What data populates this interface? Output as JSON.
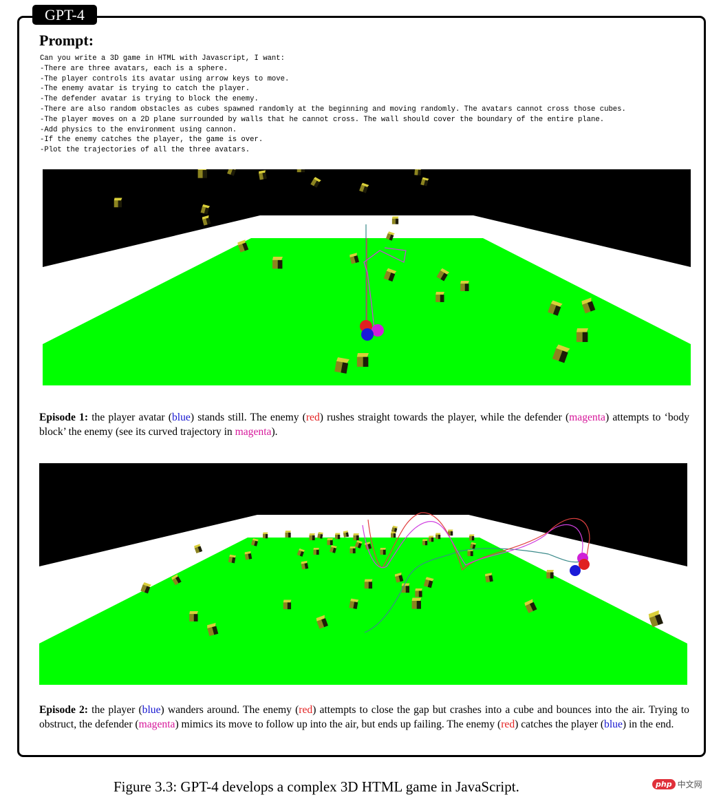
{
  "badge": "GPT-4",
  "prompt": {
    "title": "Prompt:",
    "lines": [
      "Can you write a 3D game in HTML with Javascript, I want:",
      "-There are three avatars, each is a sphere.",
      "-The player controls its avatar using arrow keys to move.",
      "-The enemy avatar is trying to catch the player.",
      "-The defender avatar is trying to block the enemy.",
      "-There are also random obstacles as cubes spawned randomly at the beginning and moving randomly. The avatars cannot cross those cubes.",
      "-The player moves on a 2D plane surrounded by walls that he cannot cross. The wall should cover the boundary of the entire plane.",
      "-Add physics to the environment using cannon.",
      "-If the enemy catches the player, the game is over.",
      "-Plot the trajectories of all the three avatars."
    ]
  },
  "colors": {
    "sky": "#000000",
    "wall": "#ffffff",
    "floor": "#00ff00",
    "cube_top": "#d9cf3a",
    "cube_side": "#8c8420",
    "cube_dark": "#1e1c08",
    "player": "#1a1ad8",
    "enemy": "#e02020",
    "defender": "#d020d8",
    "trail_player": "#3a8a8a",
    "trail_enemy": "#e04040",
    "trail_defender": "#d040e0"
  },
  "episodes": [
    {
      "label": "Episode 1:",
      "caption": [
        {
          "t": " the player avatar ("
        },
        {
          "t": "blue",
          "c": "c-blue"
        },
        {
          "t": ") stands still.  The enemy ("
        },
        {
          "t": "red",
          "c": "c-red"
        },
        {
          "t": ") rushes straight towards the player, while the defender ("
        },
        {
          "t": "magenta",
          "c": "c-mag"
        },
        {
          "t": ") attempts to ‘body block’ the enemy (see its curved trajectory in "
        },
        {
          "t": "magenta",
          "c": "c-mag"
        },
        {
          "t": ")."
        }
      ]
    },
    {
      "label": "Episode 2:",
      "caption": [
        {
          "t": " the player ("
        },
        {
          "t": "blue",
          "c": "c-blue"
        },
        {
          "t": ") wanders around.  The enemy ("
        },
        {
          "t": "red",
          "c": "c-red"
        },
        {
          "t": ") attempts to close the gap but crashes into a cube and bounces into the air.  Trying to obstruct, the defender ("
        },
        {
          "t": "magenta",
          "c": "c-mag"
        },
        {
          "t": ") mimics its move to follow up into the air, but ends up failing.  The enemy ("
        },
        {
          "t": "red",
          "c": "c-red"
        },
        {
          "t": ") catches the player ("
        },
        {
          "t": "blue",
          "c": "c-blue"
        },
        {
          "t": ") in the end."
        }
      ]
    }
  ],
  "figure_caption": "Figure 3.3: GPT-4  develops a complex 3D HTML game in JavaScript.",
  "watermark": {
    "logo": "php",
    "text": "中文网"
  }
}
